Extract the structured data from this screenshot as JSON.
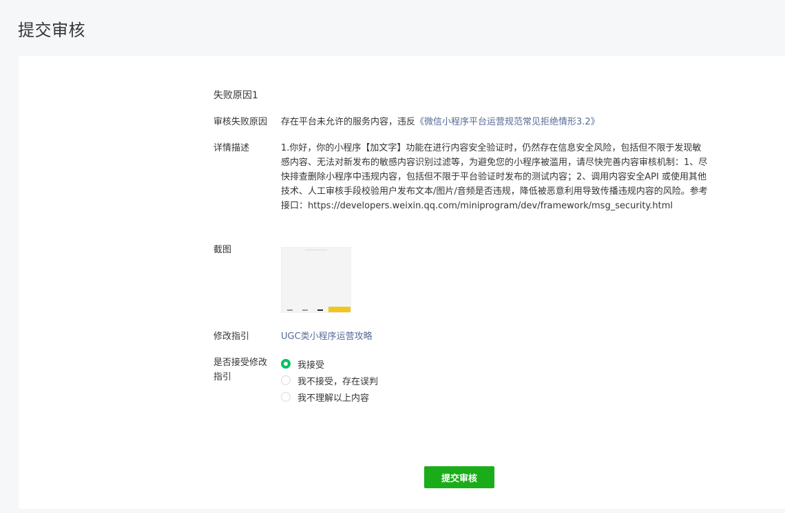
{
  "page": {
    "title": "提交审核"
  },
  "failure": {
    "section_title": "失败原因1",
    "reason": {
      "label": "审核失败原因",
      "text": "存在平台未允许的服务内容，违反",
      "link": "《微信小程序平台运营规范常见拒绝情形3.2》"
    },
    "detail": {
      "label": "详情描述",
      "text": "1.你好，你的小程序【加文字】功能在进行内容安全验证时，仍然存在信息安全风险，包括但不限于发现敏感内容、无法对新发布的敏感内容识别过滤等，为避免您的小程序被滥用，请尽快完善内容审核机制：1、尽快排查删除小程序中违规内容，包括但不限于平台验证时发布的测试内容；2、调用内容安全API 或使用其他技术、人工审核手段校验用户发布文本/图片/音频是否违规，降低被恶意利用导致传播违规内容的风险。参考接口：https://developers.weixin.qq.com/miniprogram/dev/framework/msg_security.html"
    },
    "screenshot": {
      "label": "截图"
    },
    "guide": {
      "label": "修改指引",
      "link": "UGC类小程序运营攻略"
    },
    "accept": {
      "label": "是否接受修改指引",
      "options": [
        "我接受",
        "我不接受，存在误判",
        "我不理解以上内容"
      ],
      "selected": "我接受"
    }
  },
  "actions": {
    "submit_label": "提交审核"
  },
  "colors": {
    "link": "#576b95",
    "primary": "#1aad19",
    "radio_checked": "#07c160"
  }
}
